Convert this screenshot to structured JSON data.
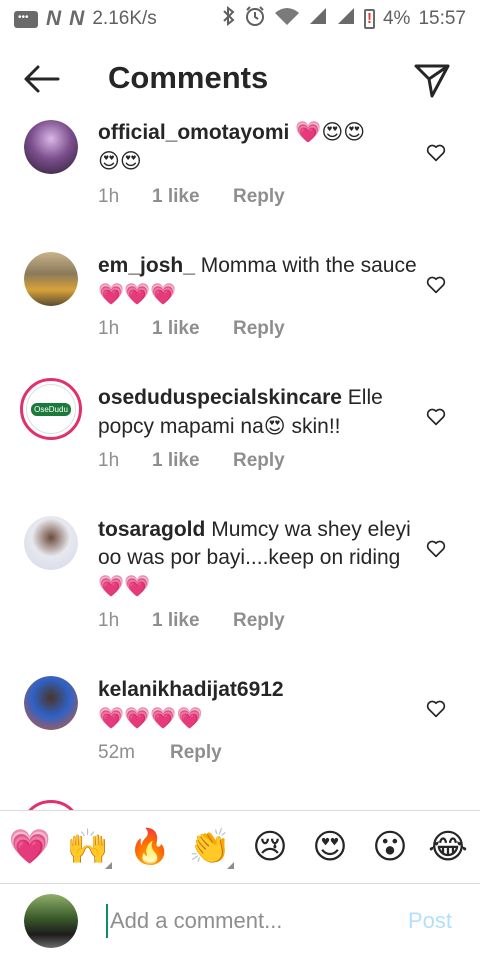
{
  "status_bar": {
    "speed": "2.16K/s",
    "battery": "4%",
    "time": "15:57",
    "icons": [
      "message-icon",
      "n-icon",
      "n-icon",
      "bluetooth-icon",
      "alarm-icon",
      "wifi-icon",
      "signal-icon",
      "signal-icon",
      "battery-alert-icon"
    ]
  },
  "header": {
    "title": "Comments",
    "back_icon": "arrow-left-icon",
    "send_icon": "paper-plane-icon"
  },
  "comments": [
    {
      "username": "official_omotayomi",
      "text": "💗😍😍\n😍😍",
      "time": "1h",
      "likes": "1 like",
      "reply": "Reply"
    },
    {
      "username": "em_josh_",
      "text": "Momma with the sauce💗💗💗",
      "time": "1h",
      "likes": "1 like",
      "reply": "Reply"
    },
    {
      "username": "oseduduspecialskincare",
      "text": "Elle popcy mapami na😍 skin!!",
      "time": "1h",
      "likes": "1 like",
      "reply": "Reply",
      "avatar_label": "OseDudu"
    },
    {
      "username": "tosaragold",
      "text": "Mumcy wa shey eleyi oo was por bayi....keep on riding💗💗",
      "time": "1h",
      "likes": "1 like",
      "reply": "Reply"
    },
    {
      "username": "kelanikhadijat6912",
      "text": "💗💗💗💗",
      "time": "52m",
      "likes": "",
      "reply": "Reply"
    }
  ],
  "emoji_bar": [
    "💗",
    "🙌",
    "🔥",
    "👏",
    "😢",
    "😍",
    "😮",
    "😂"
  ],
  "composer": {
    "placeholder": "Add a comment...",
    "post_label": "Post"
  },
  "colors": {
    "accent_pink": "#e4457f",
    "post_disabled": "#b2dffc",
    "meta_gray": "#8e8e8e",
    "divider": "#dbdbdb"
  }
}
